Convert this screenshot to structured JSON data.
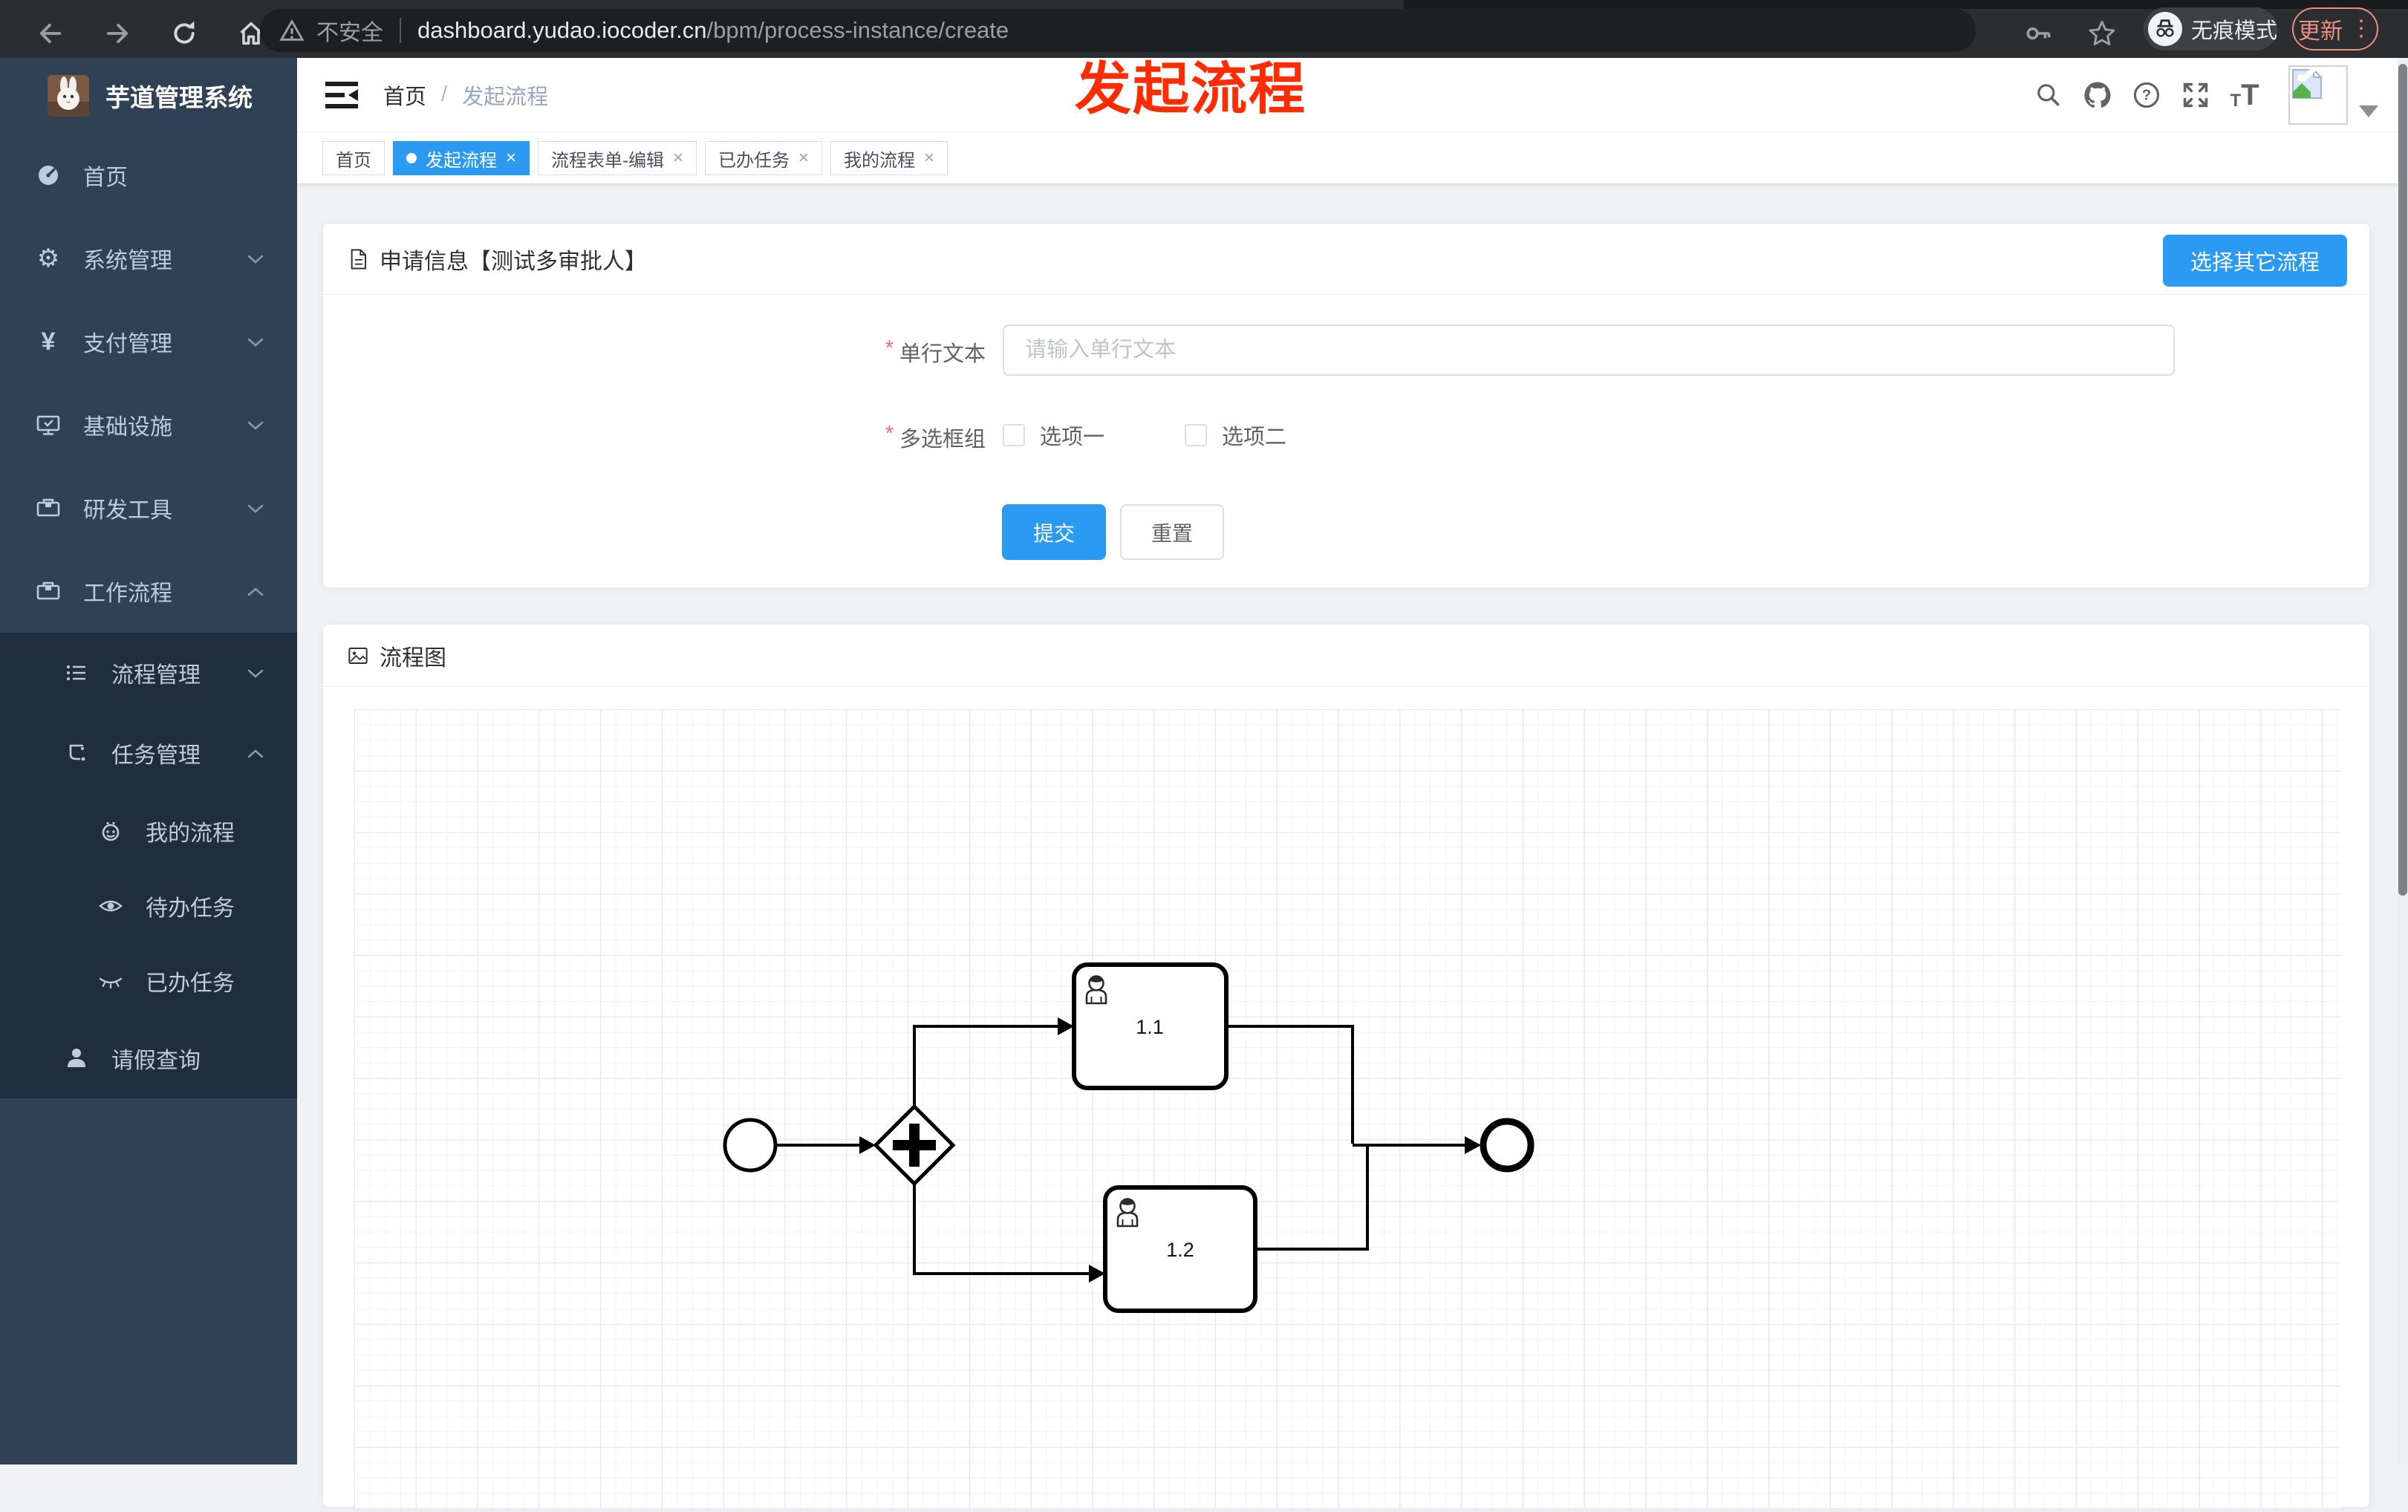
{
  "browser": {
    "security": "不安全",
    "url_host": "dashboard.yudao.iocoder.cn",
    "url_path": "/bpm/process-instance/create",
    "incognito": "无痕模式",
    "update": "更新"
  },
  "annotation": {
    "text": "发起流程",
    "color": "#fe2c00"
  },
  "sidebar": {
    "app_title": "芋道管理系统",
    "items": [
      {
        "label": "首页",
        "level": 1,
        "icon": "dashboard-icon"
      },
      {
        "label": "系统管理",
        "level": 1,
        "icon": "gear-icon",
        "expanded": false
      },
      {
        "label": "支付管理",
        "level": 1,
        "icon": "yen-icon",
        "expanded": false
      },
      {
        "label": "基础设施",
        "level": 1,
        "icon": "monitor-icon",
        "expanded": false
      },
      {
        "label": "研发工具",
        "level": 1,
        "icon": "toolbox-icon",
        "expanded": false
      },
      {
        "label": "工作流程",
        "level": 1,
        "icon": "toolbox-icon",
        "expanded": true
      },
      {
        "label": "流程管理",
        "level": 2,
        "icon": "list-icon",
        "expanded": false
      },
      {
        "label": "任务管理",
        "level": 2,
        "icon": "flow-icon",
        "expanded": true
      },
      {
        "label": "我的流程",
        "level": 3,
        "icon": "face-icon"
      },
      {
        "label": "待办任务",
        "level": 3,
        "icon": "eye-icon"
      },
      {
        "label": "已办任务",
        "level": 3,
        "icon": "eye-closed-icon"
      },
      {
        "label": "请假查询",
        "level": 2,
        "icon": "person-icon"
      }
    ]
  },
  "header": {
    "breadcrumb": [
      "首页",
      "发起流程"
    ],
    "separator": "/"
  },
  "tabs": [
    {
      "label": "首页",
      "active": false,
      "closable": false
    },
    {
      "label": "发起流程",
      "active": true,
      "closable": true
    },
    {
      "label": "流程表单-编辑",
      "active": false,
      "closable": true
    },
    {
      "label": "已办任务",
      "active": false,
      "closable": true
    },
    {
      "label": "我的流程",
      "active": false,
      "closable": true
    }
  ],
  "ui": {
    "close_symbol": "×"
  },
  "apply_card": {
    "title": "申请信息【测试多审批人】",
    "choose_button": "选择其它流程",
    "required_mark": "*",
    "fields": [
      {
        "label": "单行文本",
        "required": true,
        "placeholder": "请输入单行文本",
        "value": ""
      },
      {
        "label": "多选框组",
        "required": true,
        "options": [
          {
            "label": "选项一",
            "checked": false
          },
          {
            "label": "选项二",
            "checked": false
          }
        ]
      }
    ],
    "submit": "提交",
    "reset": "重置"
  },
  "flow_card": {
    "title": "流程图",
    "diagram": {
      "type": "bpmn",
      "nodes": [
        {
          "id": "start",
          "type": "startEvent"
        },
        {
          "id": "gateway",
          "type": "parallelGateway"
        },
        {
          "id": "task1",
          "type": "userTask",
          "label": "1.1"
        },
        {
          "id": "task2",
          "type": "userTask",
          "label": "1.2"
        },
        {
          "id": "end",
          "type": "endEvent"
        }
      ],
      "edges": [
        [
          "start",
          "gateway"
        ],
        [
          "gateway",
          "task1"
        ],
        [
          "gateway",
          "task2"
        ],
        [
          "task1",
          "end"
        ],
        [
          "task2",
          "end"
        ]
      ]
    }
  },
  "colors": {
    "primary": "#2b9af3",
    "sidebar_bg": "#304156",
    "submenu_bg": "#1f2d3d",
    "content_bg": "#f0f2f5",
    "annotation": "#fe2c00"
  }
}
